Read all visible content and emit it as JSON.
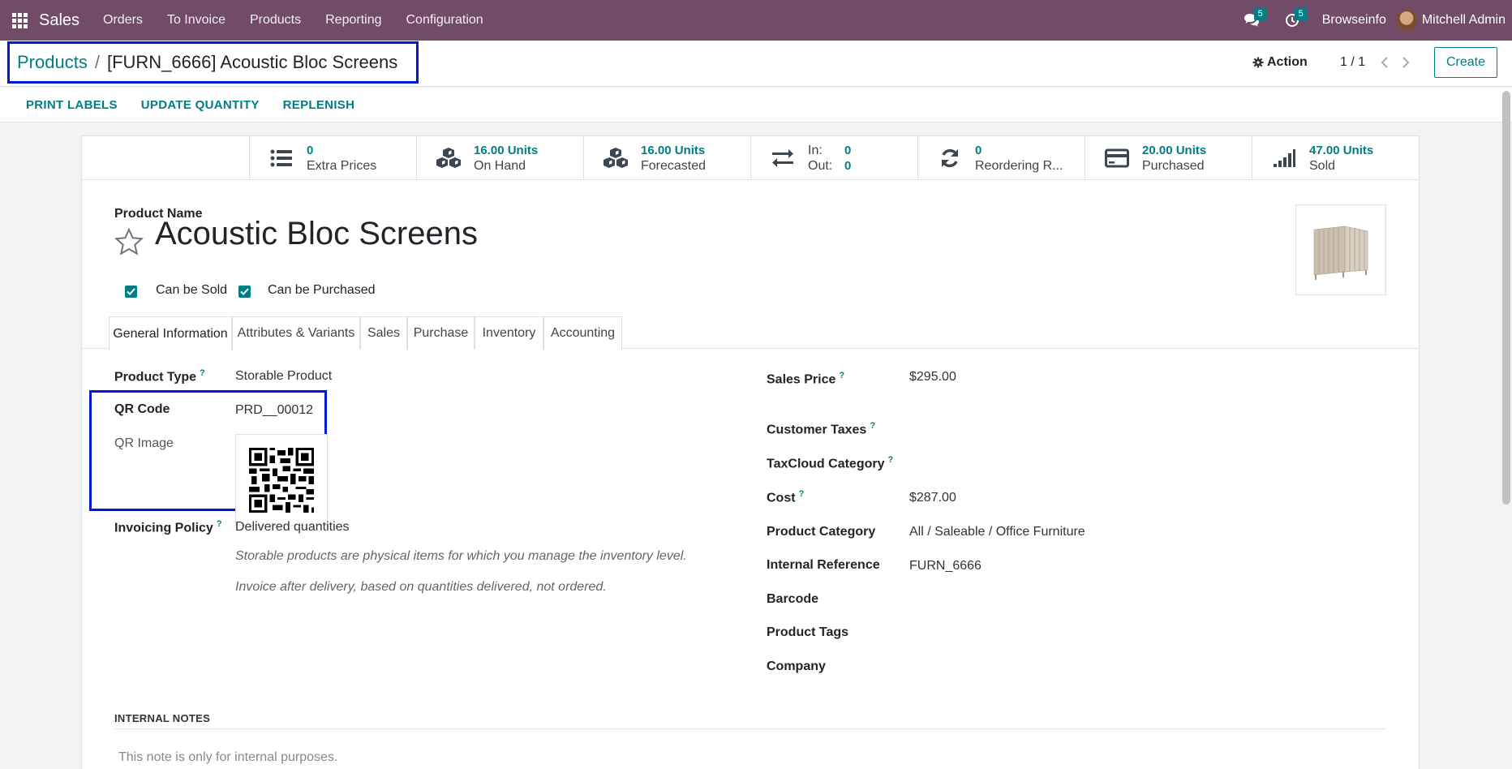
{
  "navbar": {
    "brand": "Sales",
    "menu": [
      "Orders",
      "To Invoice",
      "Products",
      "Reporting",
      "Configuration"
    ],
    "messages_count": "5",
    "activities_count": "5",
    "company": "Browseinfo",
    "user": "Mitchell Admin"
  },
  "control_panel": {
    "breadcrumb_parent": "Products",
    "breadcrumb_sep": "/",
    "breadcrumb_current": "[FURN_6666] Acoustic Bloc Screens",
    "action_label": "Action",
    "pager": "1 / 1",
    "create_label": "Create"
  },
  "status_buttons": [
    "PRINT LABELS",
    "UPDATE QUANTITY",
    "REPLENISH"
  ],
  "smart_buttons": [
    {
      "value": "0",
      "label": "Extra Prices",
      "icon": "list-icon"
    },
    {
      "value": "16.00 Units",
      "label": "On Hand",
      "icon": "cubes-icon"
    },
    {
      "value": "16.00 Units",
      "label": "Forecasted",
      "icon": "cubes-icon"
    },
    {
      "in_label": "In:",
      "in_value": "0",
      "out_label": "Out:",
      "out_value": "0",
      "icon": "exchange-icon"
    },
    {
      "value": "0",
      "label": "Reordering R...",
      "icon": "refresh-icon"
    },
    {
      "value": "20.00 Units",
      "label": "Purchased",
      "icon": "credit-card-icon"
    },
    {
      "value": "47.00 Units",
      "label": "Sold",
      "icon": "signal-icon"
    }
  ],
  "product": {
    "name_label": "Product Name",
    "name": "Acoustic Bloc Screens",
    "can_be_sold": "Can be Sold",
    "can_be_purchased": "Can be Purchased"
  },
  "tabs": [
    "General Information",
    "Attributes & Variants",
    "Sales",
    "Purchase",
    "Inventory",
    "Accounting"
  ],
  "left_fields": {
    "product_type_label": "Product Type",
    "product_type": "Storable Product",
    "qr_code_label": "QR Code",
    "qr_code": "PRD__00012",
    "qr_image_label": "QR Image",
    "invoicing_policy_label": "Invoicing Policy",
    "invoicing_policy": "Delivered quantities",
    "help_1": "Storable products are physical items for which you manage the inventory level.",
    "help_2": "Invoice after delivery, based on quantities delivered, not ordered."
  },
  "right_fields": {
    "sales_price_label": "Sales Price",
    "sales_price": "$295.00",
    "customer_taxes_label": "Customer Taxes",
    "taxcloud_label": "TaxCloud Category",
    "cost_label": "Cost",
    "cost": "$287.00",
    "category_label": "Product Category",
    "category": "All / Saleable / Office Furniture",
    "internal_ref_label": "Internal Reference",
    "internal_ref": "FURN_6666",
    "barcode_label": "Barcode",
    "tags_label": "Product Tags",
    "company_label": "Company"
  },
  "notes": {
    "title": "INTERNAL NOTES",
    "placeholder": "This note is only for internal purposes."
  },
  "help_marker": "?",
  "colors": {
    "navbar": "#714b67",
    "accent": "#017e84",
    "highlight": "#0019d4"
  }
}
